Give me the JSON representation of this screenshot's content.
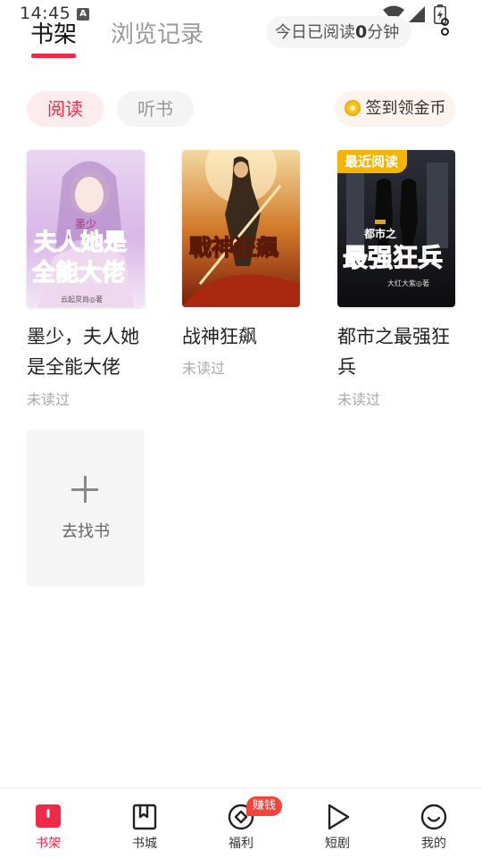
{
  "status_bar": {
    "time": "14:45",
    "notification_glyph": "A"
  },
  "header": {
    "tabs": [
      {
        "label": "书架"
      },
      {
        "label": "浏览记录"
      }
    ],
    "reading_time_prefix": "今日已阅读",
    "reading_time_value": "0",
    "reading_time_suffix": "分钟"
  },
  "filters": {
    "read": "阅读",
    "listen": "听书",
    "signin": "签到领金币"
  },
  "books": [
    {
      "title": "墨少，夫人她是全能大佬",
      "status": "未读过",
      "cover_text": "夫人她是全能大佬",
      "cover_small": "墨少",
      "cover_author": "云起炅尚◎著"
    },
    {
      "title": "战神狂飙",
      "status": "未读过",
      "cover_text": "戰神狂飆"
    },
    {
      "title": "都市之最强狂兵",
      "status": "未读过",
      "badge": "最近阅读",
      "cover_text": "最强狂兵",
      "cover_small": "都市之",
      "cover_author": "大红大紫◎著"
    }
  ],
  "add_book": {
    "label": "去找书"
  },
  "nav": {
    "items": [
      {
        "label": "书架",
        "icon": "bookshelf-icon",
        "active": true
      },
      {
        "label": "书城",
        "icon": "bookstore-icon"
      },
      {
        "label": "福利",
        "icon": "welfare-icon"
      },
      {
        "label": "短剧",
        "icon": "play-icon"
      },
      {
        "label": "我的",
        "icon": "smile-icon"
      }
    ],
    "earn_badge": "赚钱"
  },
  "colors": {
    "accent": "#ee2a48",
    "badge_gold": "#f4b400",
    "earn_red": "#f0443c"
  }
}
